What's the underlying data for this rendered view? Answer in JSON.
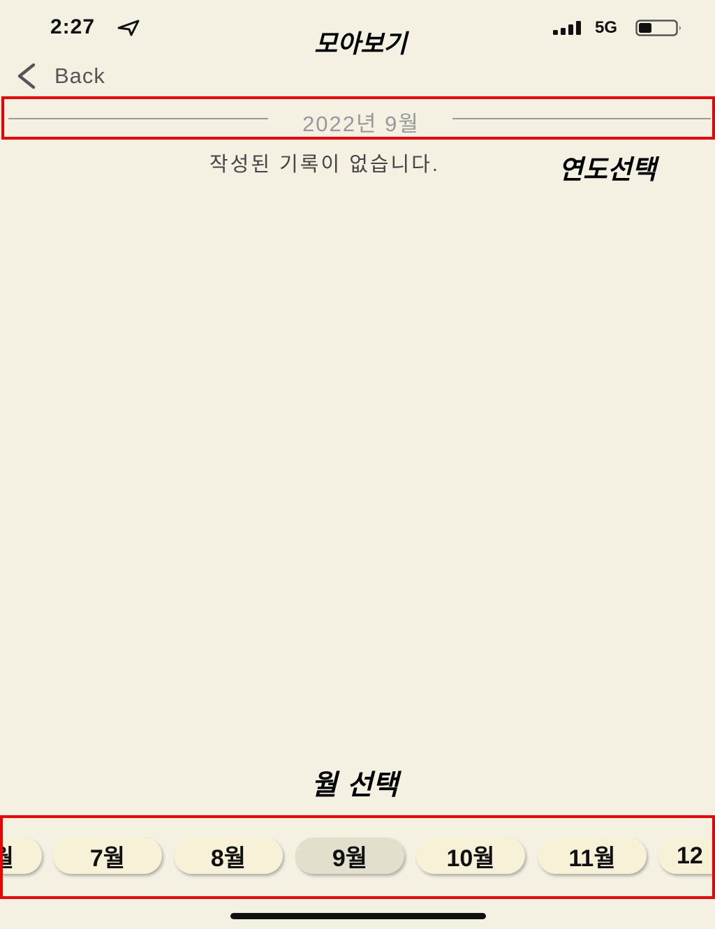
{
  "status_bar": {
    "time": "2:27",
    "network": "5G",
    "battery_level": 0.35
  },
  "annotations": {
    "title": "모아보기",
    "year_select": "연도선택",
    "month_select": "월 선택"
  },
  "nav": {
    "back_label": "Back"
  },
  "year_selector": {
    "label": "2022년 9월"
  },
  "content": {
    "empty_message": "작성된 기록이 없습니다."
  },
  "month_selector": {
    "items": [
      {
        "label": "월"
      },
      {
        "label": "7월"
      },
      {
        "label": "8월"
      },
      {
        "label": "9월"
      },
      {
        "label": "10월"
      },
      {
        "label": "11월"
      },
      {
        "label": "12"
      }
    ],
    "selected": "9월"
  },
  "colors": {
    "background": "#f4f1e3",
    "highlight_box": "#ee0000",
    "pill": "#f7f2d7",
    "pill_selected": "#e2dfcd"
  }
}
